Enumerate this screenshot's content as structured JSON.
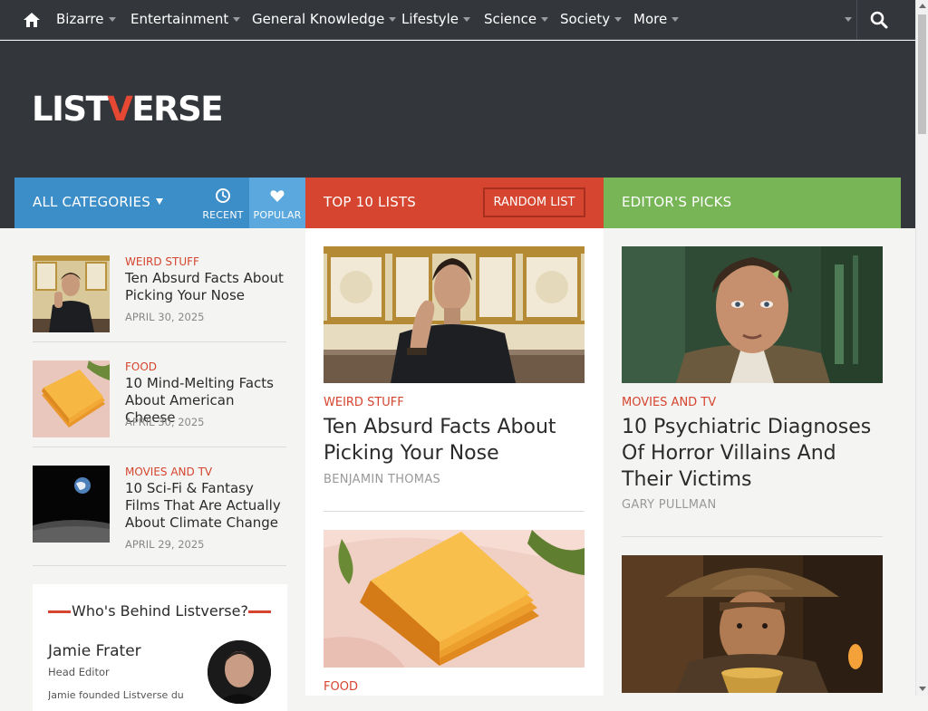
{
  "nav": {
    "items": [
      {
        "label": "Bizarre"
      },
      {
        "label": "Entertainment"
      },
      {
        "label": "General Knowledge"
      },
      {
        "label": "Lifestyle"
      },
      {
        "label": "Science"
      },
      {
        "label": "Society"
      },
      {
        "label": "More"
      }
    ],
    "icons": [
      "home-icon",
      "search-icon"
    ]
  },
  "logo": {
    "part1": "LIST",
    "part2": "V",
    "part3": "ERSE"
  },
  "bars": {
    "categories": "ALL CATEGORIES",
    "recent": "RECENT",
    "popular": "POPULAR",
    "top10": "TOP 10 LISTS",
    "random": "RANDOM LIST",
    "editors": "EDITOR'S PICKS"
  },
  "left_list": [
    {
      "category": "WEIRD STUFF",
      "title": "Ten Absurd Facts About Picking Your Nose",
      "date": "APRIL 30, 2025"
    },
    {
      "category": "FOOD",
      "title": "10 Mind-Melting Facts About American Cheese",
      "date": "APRIL 30, 2025"
    },
    {
      "category": "MOVIES AND TV",
      "title": "10 Sci-Fi & Fantasy Films That Are Actually About Climate Change",
      "date": "APRIL 29, 2025"
    }
  ],
  "who": {
    "title": "Who's Behind Listverse?",
    "name": "Jamie Frater",
    "role": "Head Editor",
    "bio": "Jamie founded Listverse due"
  },
  "top10": [
    {
      "category": "WEIRD STUFF",
      "title": "Ten Absurd Facts About Picking Your Nose",
      "author": "BENJAMIN THOMAS"
    },
    {
      "category": "FOOD"
    }
  ],
  "editors": [
    {
      "category": "MOVIES AND TV",
      "title": "10 Psychiatric Diagnoses Of Horror Villains And Their Victims",
      "author": "GARY PULLMAN"
    }
  ],
  "colors": {
    "accent_red": "#d5452f",
    "blue": "#3c8ec8",
    "green": "#77b556",
    "dark": "#33363b"
  }
}
